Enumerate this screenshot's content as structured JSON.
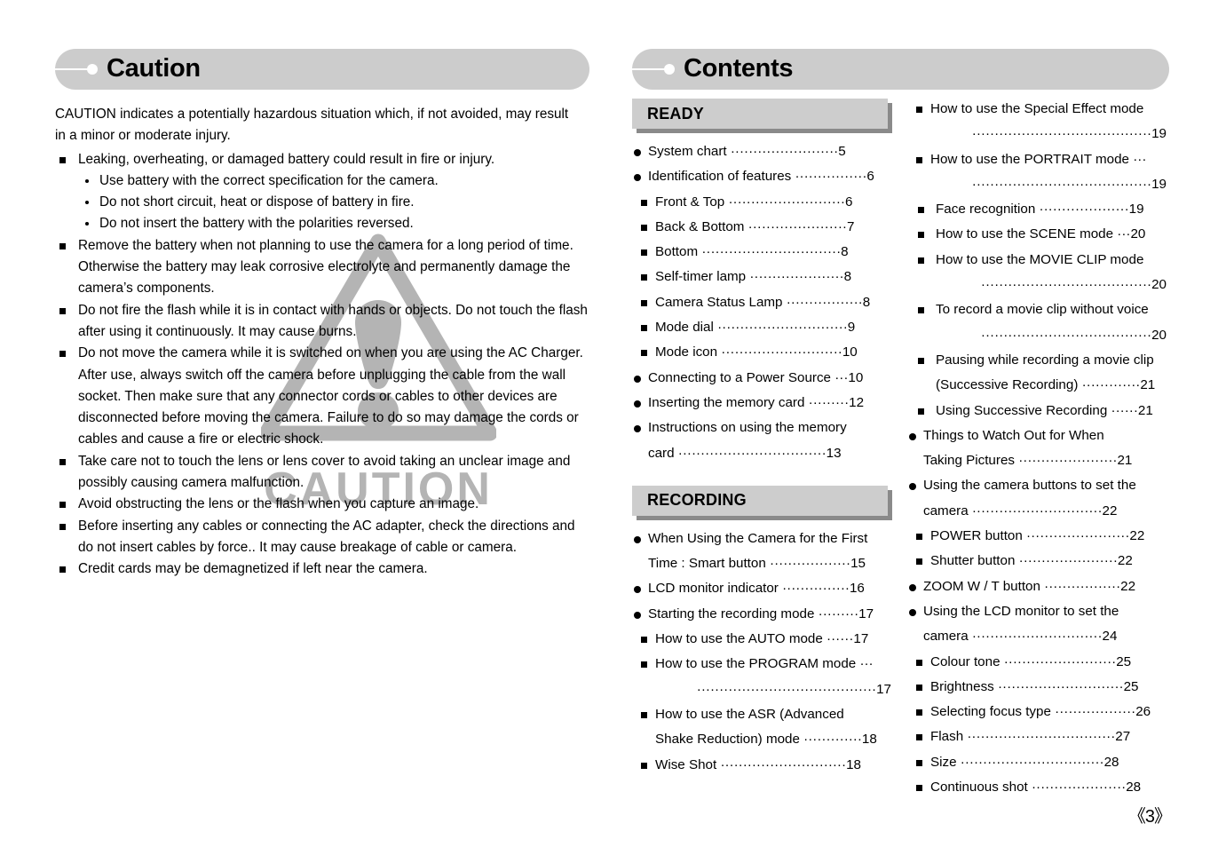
{
  "left": {
    "banner_title": "Caution",
    "intro": "CAUTION indicates a potentially hazardous situation which, if not avoided, may result in a minor or moderate injury.",
    "items": [
      {
        "text": "Leaking, overheating, or damaged battery could result in fire or injury.",
        "sub": [
          "Use battery with the correct specification for the camera.",
          "Do not short circuit, heat or dispose of battery in fire.",
          "Do not insert the battery with the polarities reversed."
        ]
      },
      {
        "text": "Remove the battery when not planning to use the camera for a long period of time. Otherwise the battery may leak corrosive electrolyte and permanently damage the camera’s components.",
        "sub": []
      },
      {
        "text": "Do not fire the flash while it is in contact with hands or objects. Do not touch the flash after using it continuously. It may cause burns.",
        "sub": []
      },
      {
        "text": "Do not move the camera while it is switched on when you are using the AC Charger. After use, always switch off the camera before unplugging the cable from the wall socket. Then make sure that any connector cords or cables to other devices are disconnected before moving the camera. Failure to do so may damage the cords or cables and cause a fire or electric shock.",
        "sub": []
      },
      {
        "text": "Take care not to touch the lens or lens cover to avoid taking an unclear image and possibly causing camera malfunction.",
        "sub": []
      },
      {
        "text": "Avoid obstructing the lens or the flash when you capture an image.",
        "sub": []
      },
      {
        "text": "Before inserting any cables or connecting the AC adapter, check the directions and do not insert cables by force.. It may cause breakage of cable or camera.",
        "sub": []
      },
      {
        "text": "Credit cards may be demagnetized if left near the camera.",
        "sub": []
      }
    ],
    "watermark": {
      "icon": "warning-triangle-icon",
      "label": "CAUTION",
      "color": "#b3b3b3"
    }
  },
  "right": {
    "banner_title": "Contents",
    "groups": {
      "ready": "READY",
      "recording": "RECORDING"
    },
    "toc_middle": [
      {
        "level": 1,
        "text": "System chart",
        "lead": "························",
        "page": "5"
      },
      {
        "level": 1,
        "text": "Identification of features",
        "lead": "················",
        "page": "6"
      },
      {
        "level": 2,
        "text": "Front & Top",
        "lead": "··························",
        "page": "6"
      },
      {
        "level": 2,
        "text": "Back & Bottom",
        "lead": "······················",
        "page": "7"
      },
      {
        "level": 2,
        "text": "Bottom",
        "lead": "·······························",
        "page": "8"
      },
      {
        "level": 2,
        "text": "Self-timer lamp",
        "lead": "·····················",
        "page": "8"
      },
      {
        "level": 2,
        "text": "Camera Status Lamp",
        "lead": "·················",
        "page": "8"
      },
      {
        "level": 2,
        "text": "Mode dial",
        "lead": "·····························",
        "page": "9"
      },
      {
        "level": 2,
        "text": "Mode icon",
        "lead": "···························",
        "page": "10"
      },
      {
        "level": 1,
        "text": "Connecting to a Power Source",
        "lead": "···",
        "page": "10"
      },
      {
        "level": 1,
        "text": "Inserting the memory card",
        "lead": "·········",
        "page": "12"
      },
      {
        "level": 1,
        "text": "Instructions on using the memory",
        "lead": "",
        "page": ""
      },
      {
        "level": 1,
        "cont": true,
        "text": "card",
        "lead": "·································",
        "page": "13"
      }
    ],
    "toc_middle2": [
      {
        "level": 1,
        "text": "When Using the Camera for the First",
        "lead": "",
        "page": ""
      },
      {
        "level": 1,
        "cont": true,
        "text": "Time : Smart button",
        "lead": "··················",
        "page": "15"
      },
      {
        "level": 1,
        "text": "LCD monitor indicator",
        "lead": "···············",
        "page": "16"
      },
      {
        "level": 1,
        "text": "Starting the recording mode",
        "lead": "·········",
        "page": "17"
      },
      {
        "level": 2,
        "text": "How to use the AUTO mode",
        "lead": "······",
        "page": "17"
      },
      {
        "level": 2,
        "text": "How to use the PROGRAM mode",
        "lead": "···",
        "page": ""
      },
      {
        "level": 2,
        "fullead": true,
        "text": "",
        "lead": "········································",
        "page": "17"
      },
      {
        "level": 2,
        "text": "How to use the ASR (Advanced",
        "lead": "",
        "page": ""
      },
      {
        "level": 2,
        "cont": true,
        "text": "Shake Reduction) mode",
        "lead": "·············",
        "page": "18"
      },
      {
        "level": 2,
        "text": "Wise Shot",
        "lead": "····························",
        "page": "18"
      }
    ],
    "toc_last": [
      {
        "level": 2,
        "text": "How to use the Special Effect mode",
        "lead": "",
        "page": ""
      },
      {
        "level": 2,
        "fullead": true,
        "text": "",
        "lead": "········································",
        "page": "19"
      },
      {
        "level": 2,
        "text": "How to use the PORTRAIT mode",
        "lead": "···",
        "page": ""
      },
      {
        "level": 2,
        "fullead": true,
        "text": "",
        "lead": "········································",
        "page": "19"
      },
      {
        "level": 3,
        "text": "Face recognition",
        "lead": "····················",
        "page": "19"
      },
      {
        "level": 3,
        "text": "How to use the SCENE mode",
        "lead": "···",
        "page": "20"
      },
      {
        "level": 3,
        "text": "How to use the MOVIE CLIP mode",
        "lead": "",
        "page": ""
      },
      {
        "level": 3,
        "fullead": true,
        "text": "",
        "lead": "······································",
        "page": "20"
      },
      {
        "level": 3,
        "text": "To record a movie clip without voice",
        "lead": "",
        "page": ""
      },
      {
        "level": 3,
        "fullead": true,
        "text": "",
        "lead": "······································",
        "page": "20"
      },
      {
        "level": 3,
        "text": "Pausing while recording a movie clip",
        "lead": "",
        "page": ""
      },
      {
        "level": 3,
        "cont": true,
        "text": "(Successive Recording)",
        "lead": "·············",
        "page": "21"
      },
      {
        "level": 3,
        "text": "Using Successive Recording",
        "lead": "······",
        "page": "21"
      },
      {
        "level": 1,
        "text": "Things to Watch Out for When",
        "lead": "",
        "page": ""
      },
      {
        "level": 1,
        "cont": true,
        "text": "Taking Pictures",
        "lead": "······················",
        "page": "21"
      },
      {
        "level": 1,
        "text": "Using the camera buttons to set the",
        "lead": "",
        "page": ""
      },
      {
        "level": 1,
        "cont": true,
        "text": "camera",
        "lead": "·····························",
        "page": "22"
      },
      {
        "level": 2,
        "text": "POWER button",
        "lead": "·······················",
        "page": "22"
      },
      {
        "level": 2,
        "text": "Shutter button",
        "lead": "······················",
        "page": "22"
      },
      {
        "level": 1,
        "text": "ZOOM W / T button",
        "lead": "·················",
        "page": "22"
      },
      {
        "level": 1,
        "text": "Using the LCD monitor to set the",
        "lead": "",
        "page": ""
      },
      {
        "level": 1,
        "cont": true,
        "text": "camera",
        "lead": "·····························",
        "page": "24"
      },
      {
        "level": 2,
        "text": "Colour tone",
        "lead": "·························",
        "page": "25"
      },
      {
        "level": 2,
        "text": "Brightness",
        "lead": "····························",
        "page": "25"
      },
      {
        "level": 2,
        "text": "Selecting focus type",
        "lead": "··················",
        "page": "26"
      },
      {
        "level": 2,
        "text": "Flash",
        "lead": "·································",
        "page": "27"
      },
      {
        "level": 2,
        "text": "Size",
        "lead": "································",
        "page": "28"
      },
      {
        "level": 2,
        "text": "Continuous shot",
        "lead": "·····················",
        "page": "28"
      }
    ]
  },
  "footer": {
    "page_number": "《3》"
  }
}
